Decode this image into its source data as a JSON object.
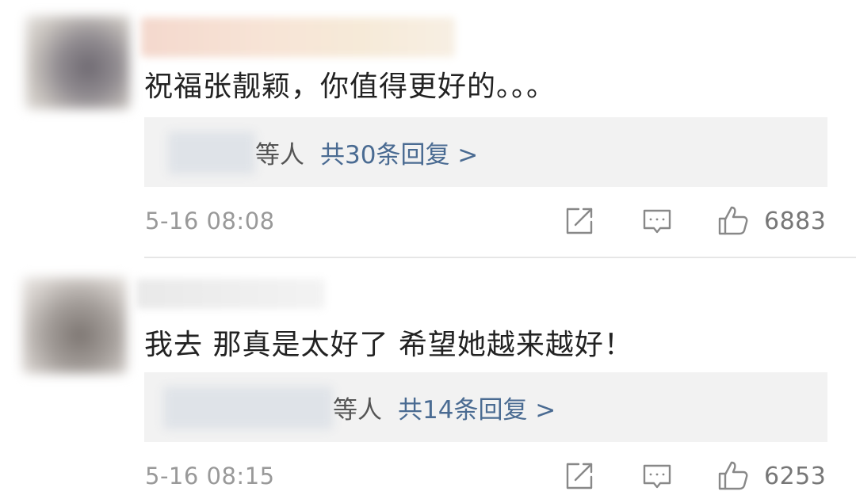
{
  "comments": [
    {
      "text": "祝福张靓颖，你值得更好的。。。",
      "reply_suffix": "等人",
      "reply_link": "共30条回复 >",
      "timestamp": "5-16 08:08",
      "like_count": "6883"
    },
    {
      "text": "我去 那真是太好了 希望她越来越好！",
      "reply_suffix": "等人",
      "reply_link": "共14条回复 >",
      "timestamp": "5-16 08:15",
      "like_count": "6253"
    }
  ],
  "icons": {
    "share": "share-icon",
    "reply": "comment-icon",
    "like": "thumbs-up-icon"
  },
  "colors": {
    "link": "#4a6b92",
    "text": "#222222",
    "meta": "#999999",
    "reply_box": "#f2f2f2"
  }
}
